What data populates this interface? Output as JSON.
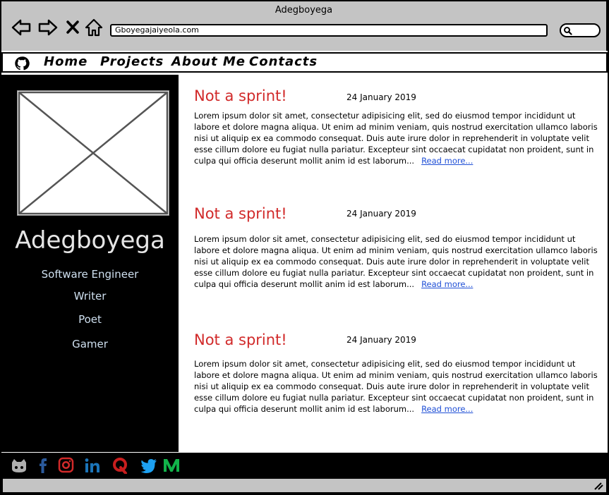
{
  "window": {
    "title": "Adegboyega"
  },
  "browser": {
    "back_icon": "arrow-left-icon",
    "forward_icon": "arrow-right-icon",
    "close_icon": "close-icon",
    "home_icon": "home-icon",
    "url": "Gboyegajaiyeola.com",
    "search_icon": "search-icon"
  },
  "menubar": {
    "logo_icon": "github-icon",
    "items": [
      {
        "label": "Home"
      },
      {
        "label": "Projects"
      },
      {
        "label": "About Me"
      },
      {
        "label": "Contacts"
      }
    ]
  },
  "sidebar": {
    "name": "Adegboyega",
    "roles": [
      {
        "label": "Software Engineer"
      },
      {
        "label": "Writer"
      },
      {
        "label": "Poet"
      },
      {
        "label": "Gamer"
      }
    ]
  },
  "posts": [
    {
      "title": "Not a sprint!",
      "date": "24 January 2019",
      "body": "Lorem ipsum dolor sit amet, consectetur adipisicing elit, sed do eiusmod tempor incididunt ut labore et dolore magna aliqua. Ut enim ad minim veniam, quis nostrud exercitation ullamco laboris nisi ut aliquip ex ea commodo consequat. Duis aute irure dolor in reprehenderit in voluptate velit esse cillum dolore eu fugiat nulla pariatur. Excepteur sint occaecat cupidatat non proident, sunt in culpa qui officia deserunt mollit anim id est laborum...",
      "link": "Read more..."
    },
    {
      "title": "Not a sprint!",
      "date": "24 January 2019",
      "body": "Lorem ipsum dolor sit amet, consectetur adipisicing elit, sed do eiusmod tempor incididunt ut labore et dolore magna aliqua. Ut enim ad minim veniam, quis nostrud exercitation ullamco laboris nisi ut aliquip ex ea commodo consequat. Duis aute irure dolor in reprehenderit in voluptate velit esse cillum dolore eu fugiat nulla pariatur. Excepteur sint occaecat cupidatat non proident, sunt in culpa qui officia deserunt mollit anim id est laborum...",
      "link": "Read more..."
    },
    {
      "title": "Not a sprint!",
      "date": "24 January 2019",
      "body": "Lorem ipsum dolor sit amet, consectetur adipisicing elit, sed do eiusmod tempor incididunt ut labore et dolore magna aliqua. Ut enim ad minim veniam, quis nostrud exercitation ullamco laboris nisi ut aliquip ex ea commodo consequat. Duis aute irure dolor in reprehenderit in voluptate velit esse cillum dolore eu fugiat nulla pariatur. Excepteur sint occaecat cupidatat non proident, sunt in culpa qui officia deserunt mollit anim id est laborum...",
      "link": "Read more..."
    }
  ],
  "footer": {
    "social_icons": [
      {
        "icon": "github-octocat-icon",
        "color": "#b0b0b0"
      },
      {
        "icon": "facebook-icon",
        "color": "#2b5a9c"
      },
      {
        "icon": "instagram-icon",
        "color": "#d12a2a"
      },
      {
        "icon": "linkedin-icon",
        "color": "#1b74b8"
      },
      {
        "icon": "quora-icon",
        "color": "#c81e1e"
      },
      {
        "icon": "twitter-icon",
        "color": "#1da1f2"
      },
      {
        "icon": "medium-icon",
        "color": "#12b34a"
      }
    ]
  },
  "colors": {
    "chrome": "#c4c4c4",
    "post_title": "#d12a2a",
    "link": "#1f4fd6",
    "sidebar_bg": "#000000",
    "role_text": "#cfe0f0"
  }
}
